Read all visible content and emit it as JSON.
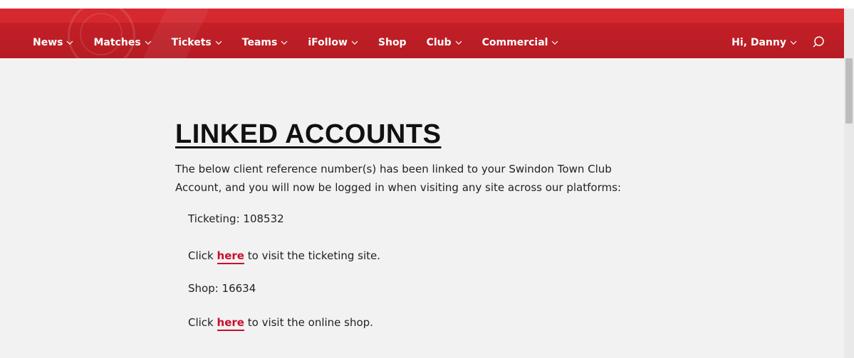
{
  "colors": {
    "brand_red": "#c41f27",
    "link_red": "#c8102e",
    "page_bg": "#f2f2f2"
  },
  "nav": {
    "items": [
      {
        "label": "News",
        "has_dropdown": true
      },
      {
        "label": "Matches",
        "has_dropdown": true
      },
      {
        "label": "Tickets",
        "has_dropdown": true
      },
      {
        "label": "Teams",
        "has_dropdown": true
      },
      {
        "label": "iFollow",
        "has_dropdown": true
      },
      {
        "label": "Shop",
        "has_dropdown": false
      },
      {
        "label": "Club",
        "has_dropdown": true
      },
      {
        "label": "Commercial",
        "has_dropdown": true
      }
    ],
    "user_label": "Hi, Danny",
    "search_icon": "search-icon"
  },
  "main": {
    "title": "LINKED ACCOUNTS",
    "intro": "The below client reference number(s) has been linked to your Swindon Town Club Account, and you will now be logged in when visiting any site across our platforms:",
    "ticketing": {
      "label": "Ticketing: 108532",
      "click_prefix": "Click",
      "link_text": "here",
      "click_suffix": "to visit the ticketing site."
    },
    "shop": {
      "label": "Shop: 16634",
      "click_prefix": "Click",
      "link_text": "here",
      "click_suffix": "to visit the online shop."
    }
  }
}
